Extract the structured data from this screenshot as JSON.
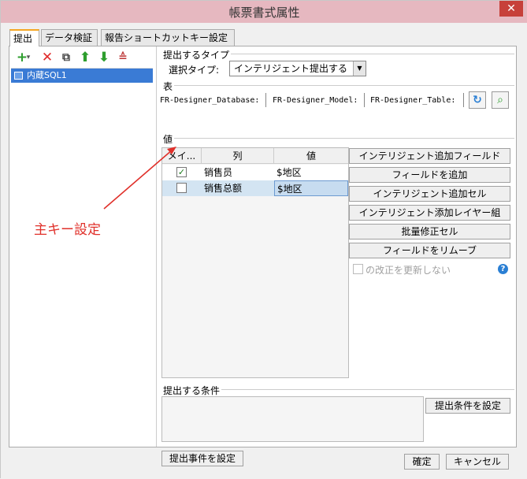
{
  "window": {
    "title": "帳票書式属性",
    "close_label": "✕"
  },
  "tabs": [
    {
      "label": "提出",
      "active": true
    },
    {
      "label": "データ検証",
      "active": false
    },
    {
      "label": "報告ショートカットキー設定",
      "active": false
    }
  ],
  "toolbar": {
    "add": "+",
    "add_caret": "▾",
    "delete": "✕",
    "copy": "⧉",
    "up": "⬆",
    "down": "⬇",
    "sort": "≙"
  },
  "tree": {
    "items": [
      {
        "label": "内蔵SQL1",
        "icon": "database-icon"
      }
    ]
  },
  "submit_type": {
    "section_label": "提出するタイプ",
    "field_label": "選択タイプ:",
    "selected": "インテリジェント提出する"
  },
  "table_section": {
    "section_label": "表",
    "database": "FR-Designer_Database:",
    "model": "FR-Designer_Model:",
    "table": "FR-Designer_Table:"
  },
  "value_section": {
    "section_label": "値",
    "columns": [
      "メイ...",
      "列",
      "値"
    ],
    "rows": [
      {
        "key": true,
        "column": "销售员",
        "value": "$地区"
      },
      {
        "key": false,
        "column": "销售总额",
        "value": "$地区"
      }
    ]
  },
  "side_buttons": [
    "インテリジェント追加フィールド",
    "フィールドを追加",
    "インテリジェント追加セル",
    "インテリジェント添加レイヤー組",
    "批量修正セル",
    "フィールドをリムーブ"
  ],
  "unmodified_option": {
    "label": "の改正を更新しない",
    "checked": false
  },
  "conditions": {
    "section_label": "提出する条件",
    "set_button": "提出条件を設定"
  },
  "submit_event_button": "提出事件を設定",
  "annotation": {
    "text": "主キー設定",
    "color": "#e0302a"
  },
  "dialog_buttons": {
    "ok": "確定",
    "cancel": "キャンセル"
  },
  "colors": {
    "title_bar": "#e6b8c0",
    "close": "#c7403a",
    "selection": "#3a7bd5",
    "active_tab": "#f5a623"
  }
}
